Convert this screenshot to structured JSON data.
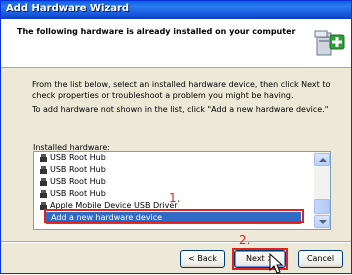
{
  "window": {
    "title": "Add Hardware Wizard"
  },
  "header": {
    "title": "The following hardware is already installed on your computer",
    "icon": "hardware-wizard-icon"
  },
  "body": {
    "description": "From the list below, select an installed hardware device, then click Next to check properties or troubleshoot a problem you might be having.",
    "add_hint": "To add hardware not shown in the list, click \"Add a new hardware device.\""
  },
  "list": {
    "label": "Installed hardware:",
    "items": [
      {
        "label": "USB Root Hub",
        "icon": "usb-icon"
      },
      {
        "label": "USB Root Hub",
        "icon": "usb-icon"
      },
      {
        "label": "USB Root Hub",
        "icon": "usb-icon"
      },
      {
        "label": "USB Root Hub",
        "icon": "usb-icon"
      },
      {
        "label": "Apple Mobile Device USB Driver",
        "icon": "usb-icon"
      },
      {
        "label": "Add a new hardware device",
        "selected": true
      }
    ]
  },
  "annotations": {
    "step1": "1.",
    "step2": "2."
  },
  "buttons": {
    "back": "< Back",
    "next": "Next >",
    "cancel": "Cancel"
  },
  "colors": {
    "titlebar": "#0a5fe0",
    "selection": "#316ac5",
    "annotation_red": "#e0241c",
    "dialog_bg": "#ece9d8"
  }
}
